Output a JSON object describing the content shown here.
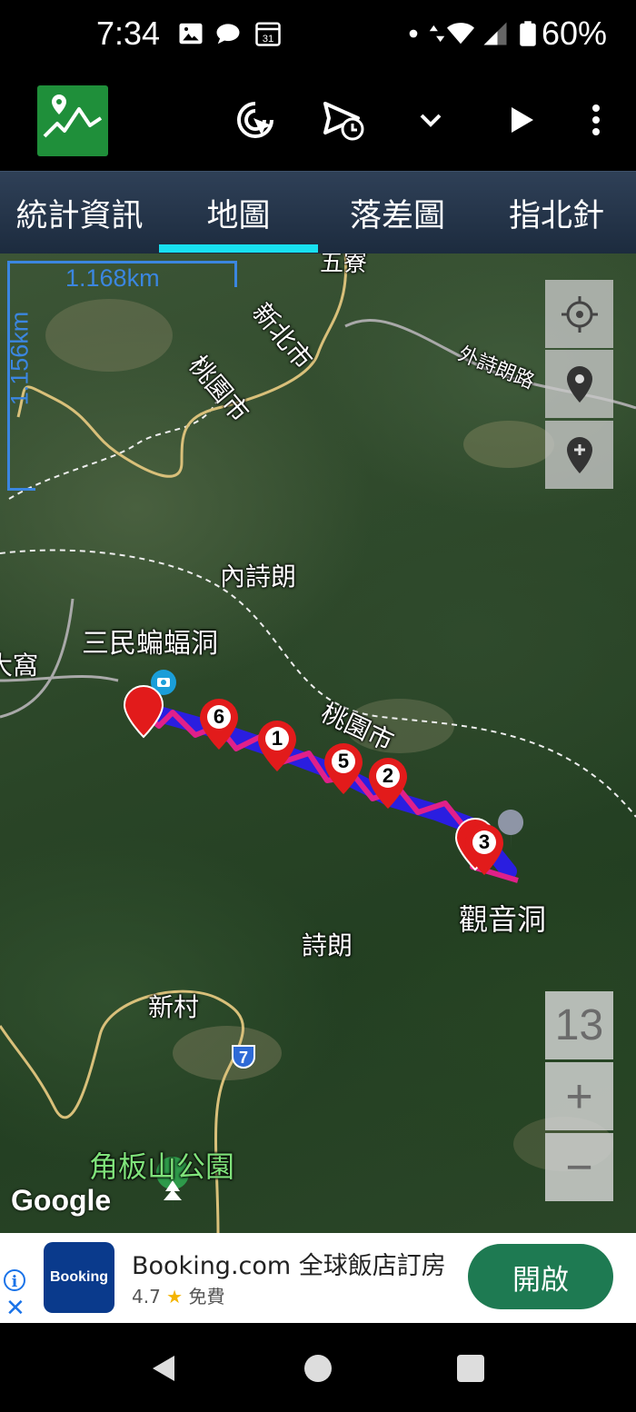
{
  "status_bar": {
    "time": "7:34",
    "calendar_day": "31",
    "battery": "60%"
  },
  "toolbar": {
    "icons": [
      "app-logo-icon",
      "gps-cursor-icon",
      "send-schedule-icon",
      "chevron-down-icon",
      "play-icon",
      "more-vert-icon"
    ]
  },
  "tabs": [
    {
      "label": "統計資訊",
      "selected": false
    },
    {
      "label": "地圖",
      "selected": true
    },
    {
      "label": "落差圖",
      "selected": false
    },
    {
      "label": "指北針",
      "selected": false
    }
  ],
  "map": {
    "scale": {
      "horizontal": "1.168km",
      "vertical": "1.156km"
    },
    "places": {
      "wuliao": "五寮",
      "xinbei": "新北市",
      "taoyuan_1": "桃園市",
      "waishi_road": "外詩朗路",
      "neishilang": "內詩朗",
      "sanmin_bat_cave": "三民蝙蝠洞",
      "taiwo": "大窩",
      "taoyuan_2": "桃園市",
      "guanyin_cave": "觀音洞",
      "shilang": "詩朗",
      "xincun": "新村",
      "jiaobanshan_park": "角板山公園",
      "route_7": "7"
    },
    "waypoints": [
      "1",
      "2",
      "3",
      "5",
      "6"
    ],
    "zoom_level": "13",
    "zoom_in": "+",
    "zoom_out": "−",
    "attribution": "Google",
    "colors": {
      "track": "#2a1ee0",
      "track_overlay": "#e0208a",
      "marker": "#e21b1b",
      "scale": "#3b86e0"
    }
  },
  "ad": {
    "brand": "Booking",
    "title": "Booking.com 全球飯店訂房",
    "rating": "4.7",
    "price": "免費",
    "cta": "開啟"
  }
}
